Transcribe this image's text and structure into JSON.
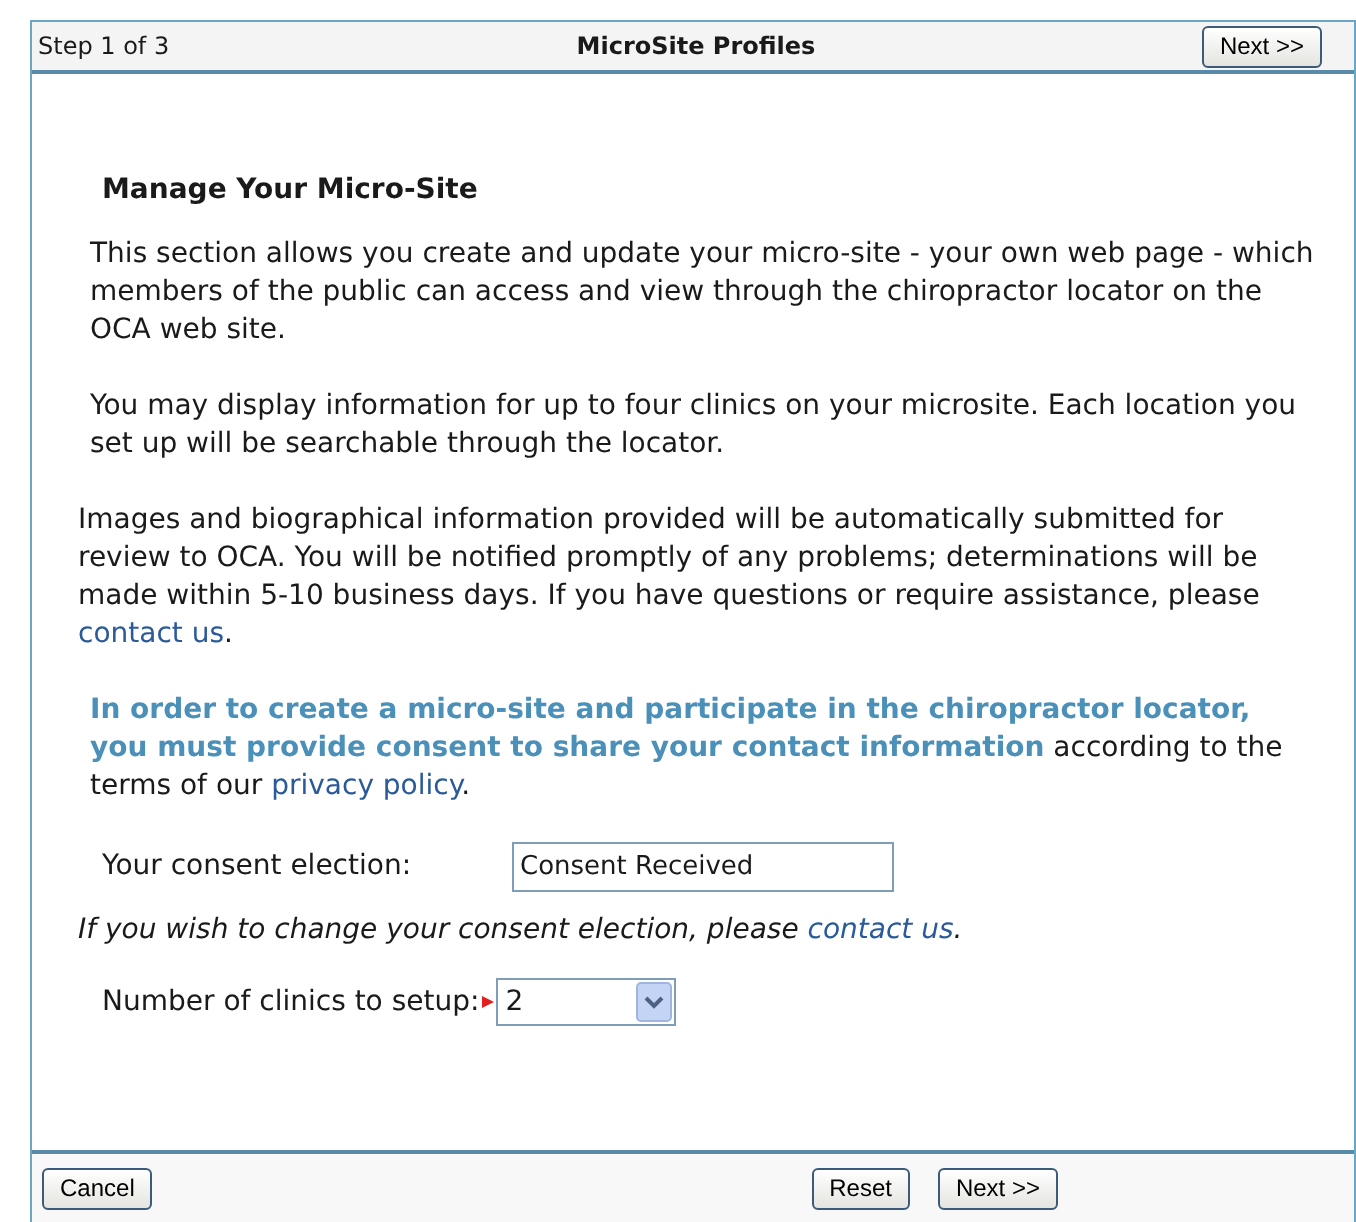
{
  "header": {
    "step": "Step 1 of 3",
    "title": "MicroSite Profiles",
    "next_button": "Next >>"
  },
  "heading": "Manage Your Micro-Site",
  "paragraphs": [
    {
      "indent": true,
      "segments": [
        {
          "kind": "text",
          "text": "This section allows you create and update your micro-site - your own web page - which members of the public can access and view through the chiropractor locator on the OCA web site."
        }
      ]
    },
    {
      "indent": true,
      "segments": [
        {
          "kind": "text",
          "text": "You may display information for up to four clinics on your microsite. Each location you set up will be searchable through the locator."
        }
      ]
    },
    {
      "indent": false,
      "segments": [
        {
          "kind": "text",
          "text": "Images and biographical information provided will be automatically submitted for review to OCA. You will be notified promptly of any problems; determinations will be made within 5-10 business days. If you have questions or require assistance, please "
        },
        {
          "kind": "link",
          "text": "contact us"
        },
        {
          "kind": "text",
          "text": "."
        }
      ]
    },
    {
      "indent": true,
      "segments": [
        {
          "kind": "emphasis",
          "text": "In order to create a micro-site and participate in the chiropractor locator, you must provide consent to share your contact information"
        },
        {
          "kind": "text",
          "text": " according to the terms of our "
        },
        {
          "kind": "link",
          "text": "privacy policy"
        },
        {
          "kind": "text",
          "text": "."
        }
      ]
    }
  ],
  "consent": {
    "label": "Your consent election:",
    "value": "Consent Received"
  },
  "consent_note": [
    {
      "kind": "text",
      "text": "If you wish to change your consent election, please "
    },
    {
      "kind": "link",
      "text": "contact us"
    },
    {
      "kind": "text",
      "text": "."
    }
  ],
  "clinics": {
    "label": "Number of clinics to setup:",
    "value": "2",
    "required": true
  },
  "footer": {
    "cancel": "Cancel",
    "reset": "Reset",
    "next": "Next >>"
  }
}
